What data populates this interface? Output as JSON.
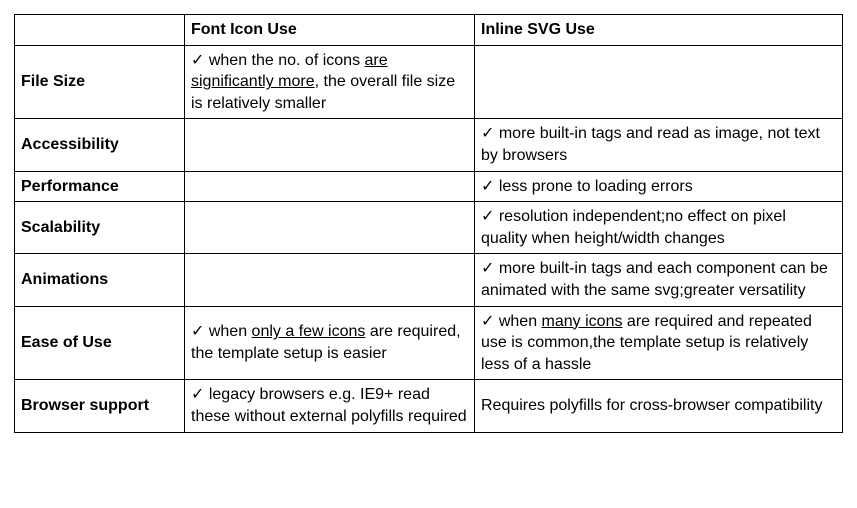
{
  "headers": {
    "corner": "",
    "colA": "Font Icon Use",
    "colB": "Inline SVG Use"
  },
  "check": "✓",
  "rows": [
    {
      "label": "File Size",
      "a": {
        "prefixCheck": true,
        "segs": [
          {
            "t": " when the no. of icons "
          },
          {
            "t": "are significantly more",
            "u": true
          },
          {
            "t": ", the overall file size is relatively smaller"
          }
        ]
      },
      "b": null
    },
    {
      "label": "Accessibility",
      "a": null,
      "b": {
        "prefixCheck": true,
        "segs": [
          {
            "t": " more built-in tags and read as image, not text by browsers"
          }
        ]
      }
    },
    {
      "label": "Performance",
      "a": null,
      "b": {
        "prefixCheck": true,
        "segs": [
          {
            "t": " less prone to loading errors"
          }
        ]
      }
    },
    {
      "label": "Scalability",
      "a": null,
      "b": {
        "prefixCheck": true,
        "segs": [
          {
            "t": " resolution independent;no effect on pixel quality when height/width changes"
          }
        ]
      }
    },
    {
      "label": "Animations",
      "a": null,
      "b": {
        "prefixCheck": true,
        "segs": [
          {
            "t": " more built-in tags and each component can be animated with the same svg;greater versatility"
          }
        ]
      }
    },
    {
      "label": "Ease of Use",
      "a": {
        "prefixCheck": true,
        "segs": [
          {
            "t": " when "
          },
          {
            "t": "only a few icons",
            "u": true
          },
          {
            "t": " are required, the template setup is easier"
          }
        ]
      },
      "b": {
        "prefixCheck": true,
        "segs": [
          {
            "t": " when "
          },
          {
            "t": "many icons",
            "u": true
          },
          {
            "t": " are required and repeated use is common,the template setup is relatively less of a hassle"
          }
        ]
      }
    },
    {
      "label": "Browser support",
      "a": {
        "prefixCheck": true,
        "segs": [
          {
            "t": " legacy browsers e.g. IE9+ read these without external polyfills required"
          }
        ]
      },
      "b": {
        "prefixCheck": false,
        "segs": [
          {
            "t": "Requires polyfills for cross-browser compatibility"
          }
        ]
      }
    }
  ]
}
